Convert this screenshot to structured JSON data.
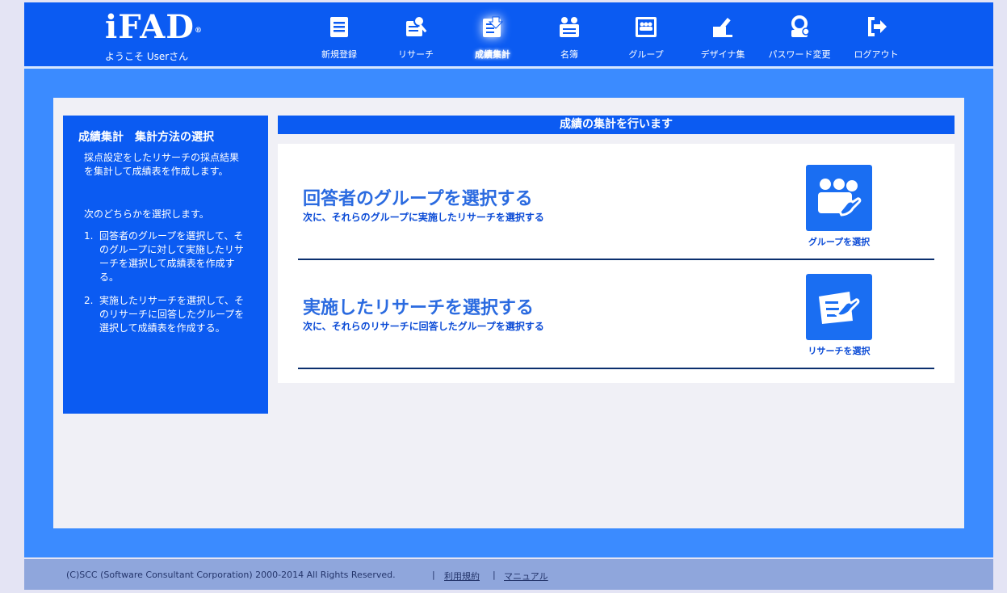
{
  "header": {
    "logo": "iFAD",
    "logo_mark": "®",
    "welcome": "ようこそ Userさん",
    "nav": [
      {
        "label": "新規登録",
        "icon": "new-registration-icon",
        "active": false
      },
      {
        "label": "リサーチ",
        "icon": "research-icon",
        "active": false
      },
      {
        "label": "成績集計",
        "icon": "grade-summary-icon",
        "active": true
      },
      {
        "label": "名簿",
        "icon": "roster-icon",
        "active": false
      },
      {
        "label": "グループ",
        "icon": "group-icon",
        "active": false
      },
      {
        "label": "デザイナ集",
        "icon": "designer-icon",
        "active": false
      },
      {
        "label": "パスワード変更",
        "icon": "password-change-icon",
        "active": false
      },
      {
        "label": "ログアウト",
        "icon": "logout-icon",
        "active": false
      }
    ]
  },
  "sidebar": {
    "title": "成績集計　集計方法の選択",
    "description": "採点設定をしたリサーチの採点結果を集計して成績表を作成します。",
    "subheading": "次のどちらかを選択します。",
    "steps": [
      {
        "num": "1.",
        "text": "回答者のグループを選択して、そのグループに対して実施したリサーチを選択して成績表を作成する。"
      },
      {
        "num": "2.",
        "text": "実施したリサーチを選択して、そのリサーチに回答したグループを選択して成績表を作成する。"
      }
    ]
  },
  "content": {
    "heading": "成績の集計を行います",
    "options": [
      {
        "title": "回答者のグループを選択する",
        "subtitle": "次に、それらのグループに実施したリサーチを選択する",
        "button_label": "グループを選択",
        "icon": "group-select-icon"
      },
      {
        "title": "実施したリサーチを選択する",
        "subtitle": "次に、それらのリサーチに回答したグループを選択する",
        "button_label": "リサーチを選択",
        "icon": "research-select-icon"
      }
    ]
  },
  "footer": {
    "copyright": "(C)SCC (Software Consultant Corporation) 2000-2014 All Rights Reserved.",
    "separator": "|",
    "terms_link": "利用規約",
    "manual_link": "マニュアル"
  },
  "colors": {
    "header_bg": "#0b5bf2",
    "main_bg": "#3b8bff",
    "panel_bg": "#f0f0f6",
    "title_blue": "#2b6be0",
    "footer_bg": "#8fa6dc"
  }
}
